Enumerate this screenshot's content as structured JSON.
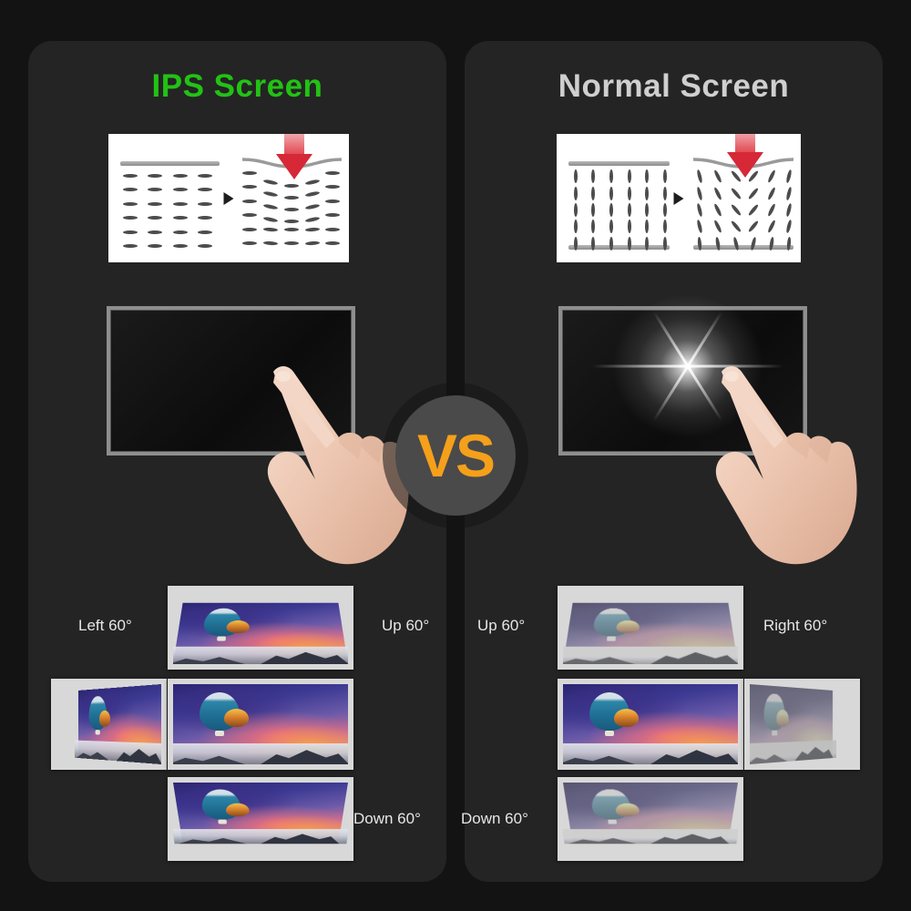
{
  "meta": {
    "background_color": "#131313",
    "panel_color": "#242424"
  },
  "panels": [
    {
      "id": "ips",
      "title": "IPS Screen",
      "title_color": "#22c215",
      "diagram": {
        "name": "molecule-pressure-diagram",
        "before_label": "aligned horizontal molecules",
        "after_label": "molecules bend under pressure",
        "orientation": "horizontal",
        "arrow_color": "#d62836"
      },
      "monitor": {
        "name": "touch-monitor",
        "glow": false,
        "frame_color": "#8e8e8e",
        "screen_color": "#121212"
      },
      "angles": {
        "center": "",
        "up": "Up 60°",
        "down": "Down 60°",
        "side": "Left 60°",
        "side_position": "left",
        "washed_out": false
      }
    },
    {
      "id": "normal",
      "title": "Normal Screen",
      "title_color": "#cfcfcf",
      "diagram": {
        "name": "molecule-pressure-diagram",
        "before_label": "aligned vertical molecules",
        "after_label": "molecules scatter under pressure",
        "orientation": "vertical",
        "arrow_color": "#d62836"
      },
      "monitor": {
        "name": "touch-monitor",
        "glow": true,
        "frame_color": "#8e8e8e",
        "screen_color": "#121212"
      },
      "angles": {
        "center": "",
        "up": "Up 60°",
        "down": "Down 60°",
        "side": "Right 60°",
        "side_position": "right",
        "washed_out": true
      }
    }
  ],
  "vs_badge": {
    "label": "VS",
    "text_color": "#f5a01a",
    "circle_color": "#4a4a4a"
  }
}
